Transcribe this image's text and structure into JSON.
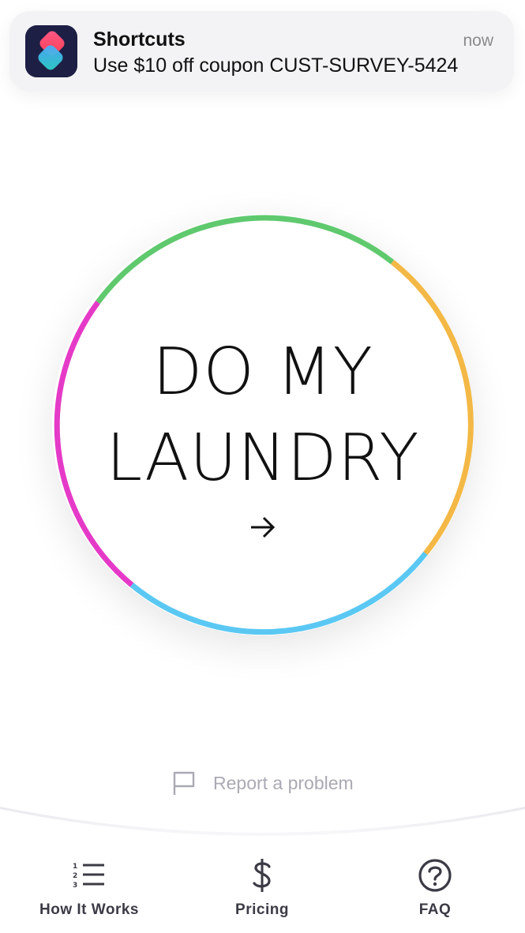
{
  "notification": {
    "app_name": "Shortcuts",
    "time": "now",
    "message": "Use $10 off coupon CUST-SURVEY-5424",
    "icon": "shortcuts-app-icon"
  },
  "main_button": {
    "line1": "DO MY",
    "line2": "LAUNDRY",
    "arrow_icon": "arrow-right-icon",
    "ring_colors": {
      "green": "#5fc96e",
      "yellow": "#f3b845",
      "blue": "#5bc8f3",
      "magenta": "#e53ac7"
    }
  },
  "report": {
    "label": "Report a problem",
    "icon": "flag-icon"
  },
  "tabbar": {
    "tabs": [
      {
        "label": "How It Works",
        "icon": "numbered-list-icon"
      },
      {
        "label": "Pricing",
        "icon": "dollar-icon"
      },
      {
        "label": "FAQ",
        "icon": "question-circle-icon"
      }
    ]
  }
}
